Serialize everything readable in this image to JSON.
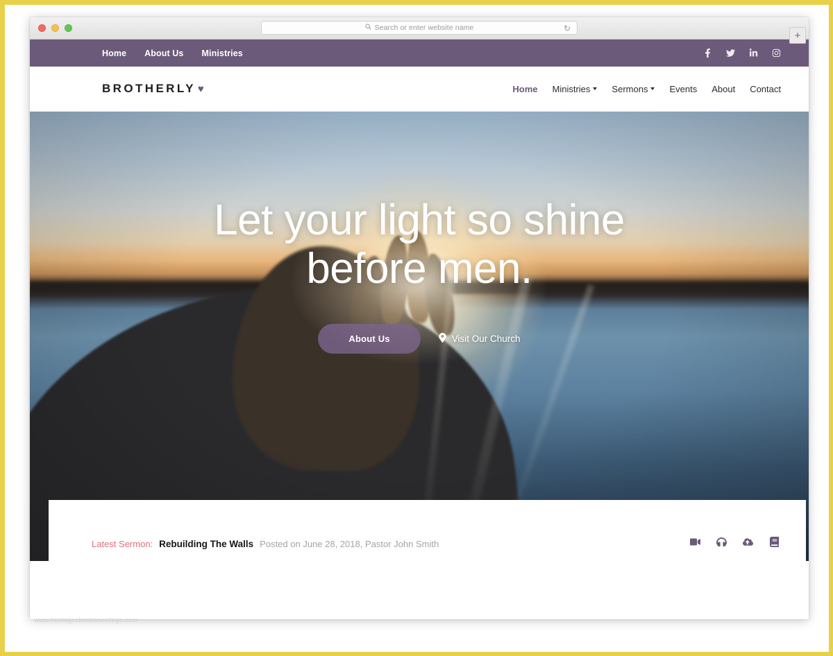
{
  "browser": {
    "traffic_lights": [
      "close",
      "minimize",
      "maximize"
    ],
    "url_placeholder": "Search or enter website name",
    "url_value": "",
    "search_icon": "search-icon",
    "reload_icon": "reload-icon",
    "newtab_label": "+"
  },
  "topbar": {
    "background": "#6b5a79",
    "links": [
      {
        "label": "Home"
      },
      {
        "label": "About Us"
      },
      {
        "label": "Ministries"
      }
    ],
    "social": [
      {
        "name": "facebook-icon"
      },
      {
        "name": "twitter-icon"
      },
      {
        "name": "linkedin-icon"
      },
      {
        "name": "instagram-icon"
      }
    ]
  },
  "header": {
    "brand": "BROTHERLY",
    "brand_heart": "♥",
    "nav": [
      {
        "label": "Home",
        "active": true,
        "dropdown": false
      },
      {
        "label": "Ministries",
        "active": false,
        "dropdown": true
      },
      {
        "label": "Sermons",
        "active": false,
        "dropdown": true
      },
      {
        "label": "Events",
        "active": false,
        "dropdown": false
      },
      {
        "label": "About",
        "active": false,
        "dropdown": false
      },
      {
        "label": "Contact",
        "active": false,
        "dropdown": false
      }
    ]
  },
  "hero": {
    "title_line1": "Let your light so shine",
    "title_line2": "before men.",
    "primary_button": "About Us",
    "secondary_link": "Visit Our Church",
    "secondary_icon": "map-pin-icon",
    "accent": "#7c658d"
  },
  "sermon": {
    "label": "Latest Sermon:",
    "title": "Rebuilding The Walls",
    "meta": "Posted on June 28, 2018, Pastor John Smith",
    "label_color": "#e06d7d",
    "icon_color": "#6b5a79",
    "icons": [
      {
        "name": "video-camera-icon"
      },
      {
        "name": "headphones-icon"
      },
      {
        "name": "cloud-download-icon"
      },
      {
        "name": "book-icon"
      }
    ]
  },
  "watermark": "www.heritagechristiancollege.com"
}
